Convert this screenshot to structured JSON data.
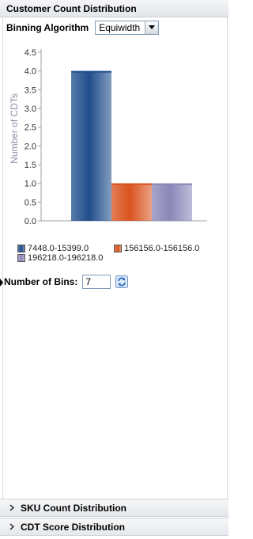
{
  "panel": {
    "title": "Customer Count Distribution"
  },
  "binning": {
    "label": "Binning Algorithm",
    "selected": "Equiwidth"
  },
  "bins": {
    "label": "Number of Bins:",
    "value": "7"
  },
  "accordion": [
    {
      "label": "SKU Count Distribution"
    },
    {
      "label": "CDT Score Distribution"
    }
  ],
  "icons": {
    "refresh": "refresh-icon",
    "dropdown": "chevron-down-icon",
    "expand": "chevron-right-icon"
  },
  "chart_data": {
    "type": "bar",
    "title": "",
    "xlabel": "",
    "ylabel": "Number of CDTs",
    "ylim": [
      0,
      4.5
    ],
    "yticks": [
      "0.0",
      "0.5",
      "1.0",
      "1.5",
      "2.0",
      "2.5",
      "3.0",
      "3.5",
      "4.0",
      "4.5"
    ],
    "grid": false,
    "legend_position": "bottom",
    "series": [
      {
        "name": "7448.0-15399.0",
        "values": [
          4
        ],
        "color": "#1f4e8c"
      },
      {
        "name": "156156.0-156156.0",
        "values": [
          1
        ],
        "color": "#d9531e"
      },
      {
        "name": "196218.0-196218.0",
        "values": [
          1
        ],
        "color": "#8a86b8"
      }
    ]
  }
}
